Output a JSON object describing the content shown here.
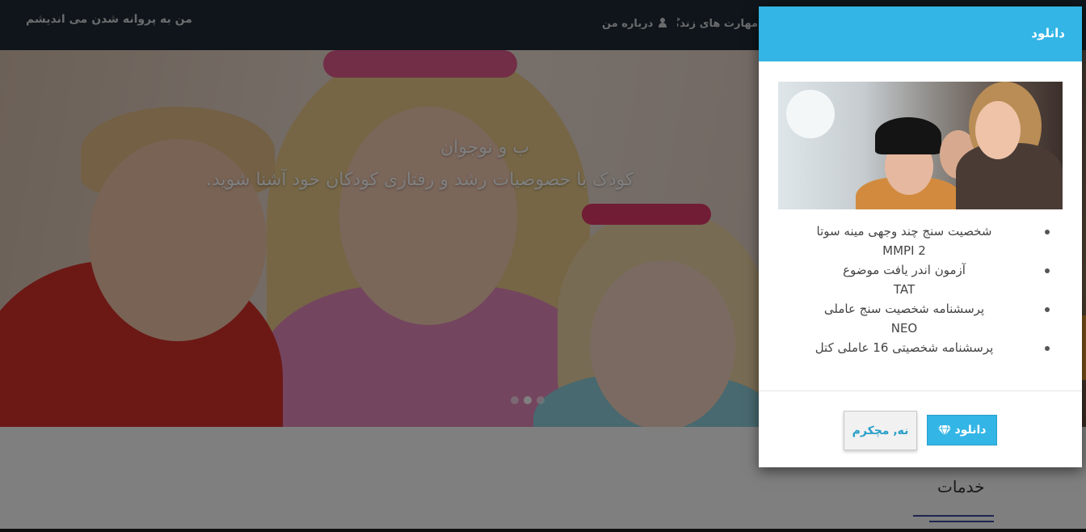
{
  "navbar": {
    "brand": "من به پروانه شدن می اندیشم",
    "about_label": "درباره من",
    "skills_label": "مهارت های زندگی"
  },
  "hero": {
    "caption_line1": "ب و نوجوان",
    "caption_line2": "کودک با خصوصیات رشد و رفتاری کودکان خود آشنا شوید.",
    "slides_count": 3,
    "active_slide": 2
  },
  "services": {
    "title": "خدمات"
  },
  "modal": {
    "title": "دانلود",
    "items": [
      {
        "text": "شخصیت سنج چند وجهی مینه سوتا",
        "code": "MMPI 2"
      },
      {
        "text": "آزمون اندر یافت موضوع",
        "code": "TAT"
      },
      {
        "text": "پرسشنامه شخصیت سنج عاملی",
        "code": "NEO"
      },
      {
        "text": "پرسشنامه شخصیتی 16 عاملی کتل",
        "code": ""
      }
    ],
    "download_button": "دانلود",
    "no_button": "نه, مچکرم"
  },
  "colors": {
    "navbar": "#1e2a35",
    "accent": "#33b5e5",
    "overlay": "rgba(0,0,0,0.5)"
  }
}
